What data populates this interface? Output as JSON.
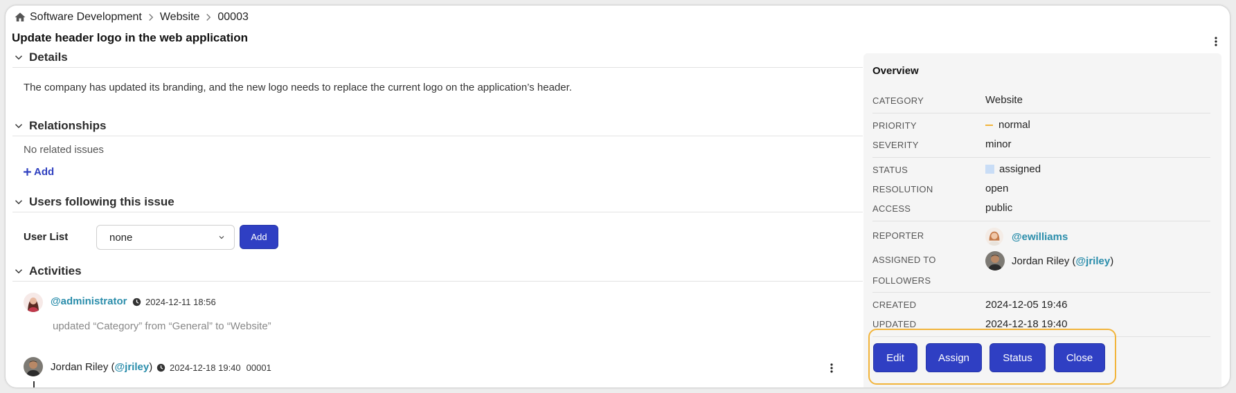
{
  "breadcrumb": {
    "items": [
      "Software Development",
      "Website",
      "00003"
    ]
  },
  "title": "Update header logo in the web application",
  "sections": {
    "details": {
      "label": "Details",
      "text": "The company has updated its branding, and the new logo needs to replace the current logo on the application’s header."
    },
    "relationships": {
      "label": "Relationships",
      "empty_text": "No related issues",
      "add_label": "Add"
    },
    "followers": {
      "label": "Users following this issue",
      "user_list_label": "User List",
      "select_value": "none",
      "add_button": "Add"
    },
    "activities": {
      "label": "Activities"
    }
  },
  "activities": [
    {
      "user": "@administrator",
      "time": "2024-12-11 18:56",
      "text": "updated “Category” from “General” to “Website”"
    },
    {
      "user_name": "Jordan Riley",
      "user_handle": "@jriley",
      "time": "2024-12-18 19:40",
      "ref": "00001"
    }
  ],
  "overview": {
    "title": "Overview",
    "category": {
      "label": "CATEGORY",
      "value": "Website"
    },
    "priority": {
      "label": "PRIORITY",
      "value": "normal",
      "color": "#f2b43a"
    },
    "severity": {
      "label": "SEVERITY",
      "value": "minor"
    },
    "status": {
      "label": "STATUS",
      "value": "assigned",
      "color": "#c9ddf6"
    },
    "resolution": {
      "label": "RESOLUTION",
      "value": "open"
    },
    "access": {
      "label": "ACCESS",
      "value": "public"
    },
    "reporter": {
      "label": "REPORTER",
      "value": "@ewilliams"
    },
    "assigned_to": {
      "label": "ASSIGNED TO",
      "name": "Jordan Riley",
      "handle": "@jriley"
    },
    "followers": {
      "label": "FOLLOWERS"
    },
    "created": {
      "label": "CREATED",
      "value": "2024-12-05 19:46"
    },
    "updated": {
      "label": "UPDATED",
      "value": "2024-12-18 19:40"
    }
  },
  "actions": {
    "edit": "Edit",
    "assign": "Assign",
    "status": "Status",
    "close": "Close"
  },
  "colors": {
    "accent": "#2f3fc3",
    "link": "#2a8dab",
    "highlight": "#f2b43a"
  }
}
